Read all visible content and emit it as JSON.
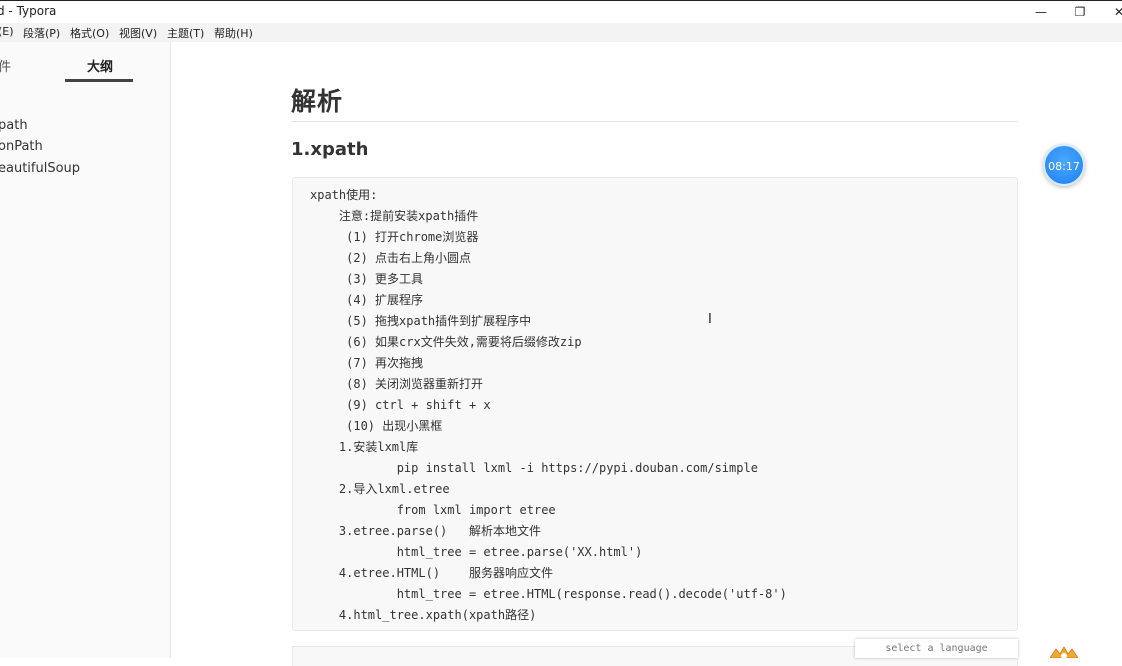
{
  "window": {
    "title": "d - Typora",
    "minimize": "—",
    "restore": "❐",
    "close": "✕"
  },
  "menu": [
    "(E)",
    "段落(P)",
    "格式(O)",
    "视图(V)",
    "主题(T)",
    "帮助(H)"
  ],
  "sidebar": {
    "tab_files": "件",
    "tab_outline": "大纲",
    "outline_items": [
      "path",
      "onPath",
      "eautifulSoup"
    ]
  },
  "doc": {
    "h1": "解析",
    "h2": "1.xpath",
    "code_lines": [
      "xpath使用:",
      "    注意:提前安装xpath插件",
      "     (1) 打开chrome浏览器",
      "     (2) 点击右上角小圆点",
      "     (3) 更多工具",
      "     (4) 扩展程序",
      "     (5) 拖拽xpath插件到扩展程序中",
      "     (6) 如果crx文件失效,需要将后缀修改zip",
      "     (7) 再次拖拽",
      "     (8) 关闭浏览器重新打开",
      "     (9) ctrl + shift + x",
      "     (10) 出现小黑框",
      "    1.安装lxml库",
      "            pip install lxml -i https://pypi.douban.com/simple",
      "    2.导入lxml.etree",
      "            from lxml import etree",
      "    3.etree.parse()   解析本地文件",
      "            html_tree = etree.parse('XX.html')",
      "    4.etree.HTML()    服务器响应文件",
      "            html_tree = etree.HTML(response.read().decode('utf-8')",
      "    4.html_tree.xpath(xpath路径)"
    ],
    "language_placeholder": "select a language"
  },
  "overlay": {
    "clock_time": "08:17"
  },
  "colors": {
    "accent": "#1f7ff0",
    "code_bg": "#f8f8f8",
    "sidebar_bg": "#fafafa"
  }
}
